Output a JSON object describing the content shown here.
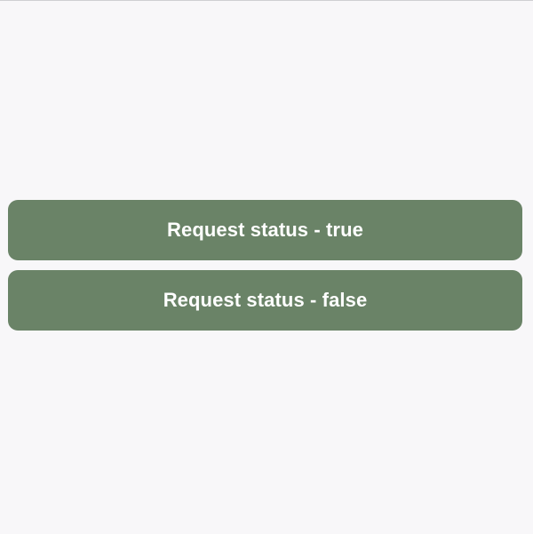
{
  "screen": {
    "background": "#f8f7f9",
    "buttons": [
      {
        "label": "Request status - true",
        "color": "#6a8367"
      },
      {
        "label": "Request status - false",
        "color": "#6a8367"
      }
    ]
  }
}
